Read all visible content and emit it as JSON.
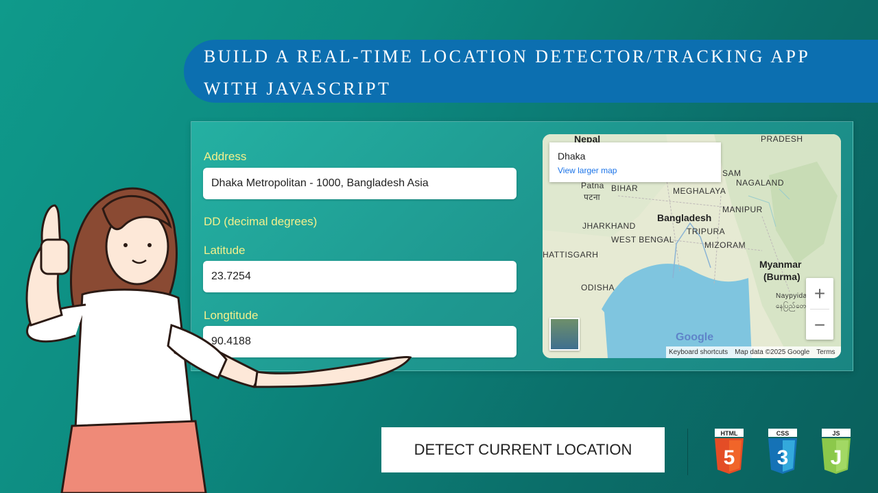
{
  "banner": {
    "line1": "BUILD A REAL-TIME LOCATION DETECTOR/TRACKING APP",
    "line2": "WITH JAVASCRIPT"
  },
  "form": {
    "address_label": "Address",
    "address_value": "Dhaka Metropolitan -  1000, Bangladesh Asia",
    "section_label": "DD (decimal degrees)",
    "latitude_label": "Latitude",
    "latitude_value": "23.7254",
    "longitude_label": "Longtitude",
    "longitude_value": "90.4188"
  },
  "map": {
    "info_title": "Dhaka",
    "info_link": "View larger map",
    "labels": {
      "nepal": "Nepal",
      "pradesh": "PRADESH",
      "patna": "Patna",
      "patna_local": "पटना",
      "bihar": "BIHAR",
      "meghalaya": "MEGHALAYA",
      "nagaland": "NAGALAND",
      "sam": "SAM",
      "manipur": "MANIPUR",
      "jharkhand": "JHARKHAND",
      "bangladesh": "Bangladesh",
      "tripura": "TRIPURA",
      "west_bengal": "WEST BENGAL",
      "mizoram": "MIZORAM",
      "chhattisgarh": "HATTISGARH",
      "myanmar": "Myanmar",
      "burma": "(Burma)",
      "odisha": "ODISHA",
      "naypyidaw": "Naypyidaw",
      "naypyidaw_local": "နေပြည်တော်"
    },
    "zoom_in": "+",
    "zoom_out": "−",
    "google": "Google",
    "footer": [
      "Keyboard shortcuts",
      "Map data ©2025 Google",
      "Terms"
    ]
  },
  "detect_button": "DETECT CURRENT LOCATION",
  "badges": [
    {
      "label": "HTML",
      "digit": "5",
      "color": "#e44d26"
    },
    {
      "label": "CSS",
      "digit": "3",
      "color": "#1572b6"
    },
    {
      "label": "JS",
      "digit": "J",
      "color": "#8cc84b"
    }
  ],
  "colors": {
    "banner": "#0c6fb0",
    "label": "#f3f08c",
    "background": "#0d8a80"
  }
}
